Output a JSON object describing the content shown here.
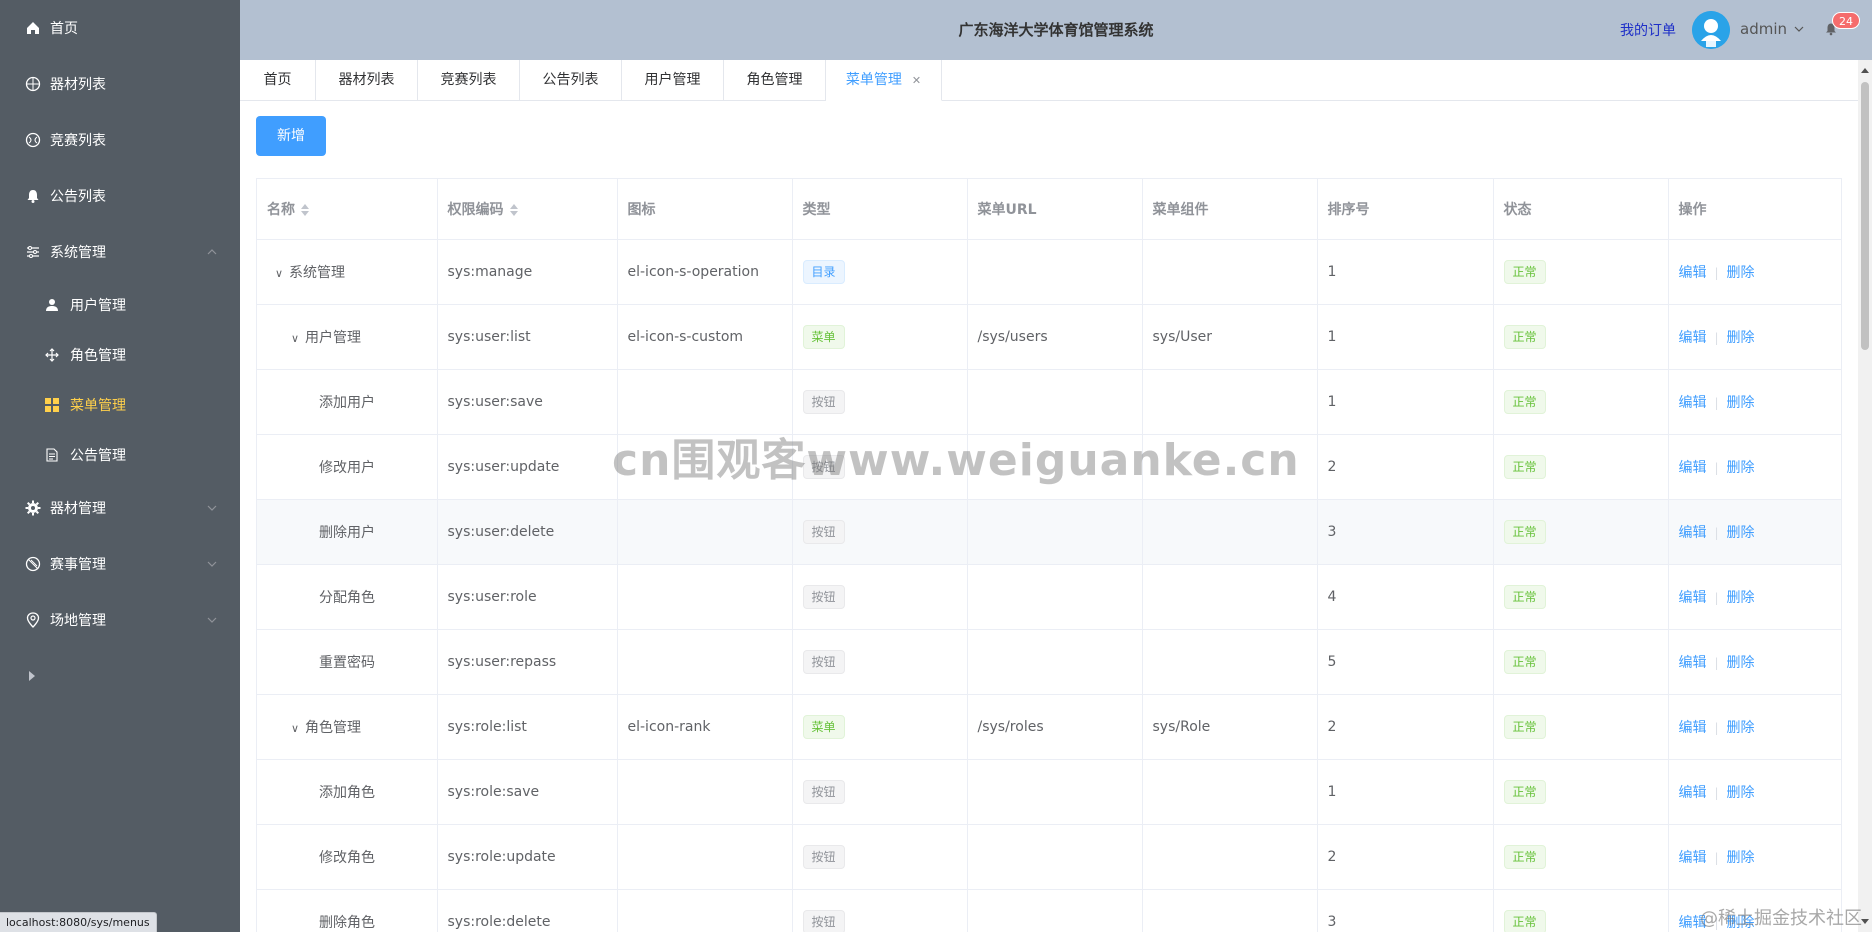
{
  "sidebar": {
    "items": [
      {
        "label": "首页",
        "icon": "home-icon"
      },
      {
        "label": "器材列表",
        "icon": "basketball-icon"
      },
      {
        "label": "竞赛列表",
        "icon": "baseball-icon"
      },
      {
        "label": "公告列表",
        "icon": "bell-icon"
      },
      {
        "label": "系统管理",
        "icon": "sliders-icon"
      },
      {
        "label": "器材管理",
        "icon": "gear-icon"
      },
      {
        "label": "赛事管理",
        "icon": "football-icon"
      },
      {
        "label": "场地管理",
        "icon": "location-icon"
      }
    ],
    "sub_items": [
      {
        "label": "用户管理",
        "icon": "user-icon"
      },
      {
        "label": "角色管理",
        "icon": "rank-icon"
      },
      {
        "label": "菜单管理",
        "icon": "grid-icon"
      },
      {
        "label": "公告管理",
        "icon": "document-icon"
      }
    ],
    "active_sub": "菜单管理"
  },
  "status_bar_url": "localhost:8080/sys/menus",
  "header": {
    "title": "广东海洋大学体育馆管理系统",
    "my_orders": "我的订单",
    "username": "admin",
    "notification_count": "24"
  },
  "tabs": [
    {
      "label": "首页"
    },
    {
      "label": "器材列表"
    },
    {
      "label": "竞赛列表"
    },
    {
      "label": "公告列表"
    },
    {
      "label": "用户管理"
    },
    {
      "label": "角色管理"
    },
    {
      "label": "菜单管理",
      "active": true,
      "closable": true
    }
  ],
  "toolbar": {
    "add_label": "新增"
  },
  "table": {
    "columns": [
      "名称",
      "权限编码",
      "图标",
      "类型",
      "菜单URL",
      "菜单组件",
      "排序号",
      "状态",
      "操作"
    ],
    "edit_label": "编辑",
    "delete_label": "删除",
    "rows": [
      {
        "name": "系统管理",
        "perm": "sys:manage",
        "icon": "el-icon-s-operation",
        "type": "目录",
        "url": "",
        "component": "",
        "order": "1",
        "status": "正常"
      },
      {
        "name": "用户管理",
        "perm": "sys:user:list",
        "icon": "el-icon-s-custom",
        "type": "菜单",
        "url": "/sys/users",
        "component": "sys/User",
        "order": "1",
        "status": "正常"
      },
      {
        "name": "添加用户",
        "perm": "sys:user:save",
        "icon": "",
        "type": "按钮",
        "url": "",
        "component": "",
        "order": "1",
        "status": "正常"
      },
      {
        "name": "修改用户",
        "perm": "sys:user:update",
        "icon": "",
        "type": "按钮",
        "url": "",
        "component": "",
        "order": "2",
        "status": "正常"
      },
      {
        "name": "删除用户",
        "perm": "sys:user:delete",
        "icon": "",
        "type": "按钮",
        "url": "",
        "component": "",
        "order": "3",
        "status": "正常"
      },
      {
        "name": "分配角色",
        "perm": "sys:user:role",
        "icon": "",
        "type": "按钮",
        "url": "",
        "component": "",
        "order": "4",
        "status": "正常"
      },
      {
        "name": "重置密码",
        "perm": "sys:user:repass",
        "icon": "",
        "type": "按钮",
        "url": "",
        "component": "",
        "order": "5",
        "status": "正常"
      },
      {
        "name": "角色管理",
        "perm": "sys:role:list",
        "icon": "el-icon-rank",
        "type": "菜单",
        "url": "/sys/roles",
        "component": "sys/Role",
        "order": "2",
        "status": "正常"
      },
      {
        "name": "添加角色",
        "perm": "sys:role:save",
        "icon": "",
        "type": "按钮",
        "url": "",
        "component": "",
        "order": "1",
        "status": "正常"
      },
      {
        "name": "修改角色",
        "perm": "sys:role:update",
        "icon": "",
        "type": "按钮",
        "url": "",
        "component": "",
        "order": "2",
        "status": "正常"
      },
      {
        "name": "删除角色",
        "perm": "sys:role:delete",
        "icon": "",
        "type": "按钮",
        "url": "",
        "component": "",
        "order": "3",
        "status": "正常"
      }
    ]
  },
  "watermarks": {
    "center": "cn围观客www.weiguanke.cn",
    "corner": "@稀土掘金技术社区"
  },
  "colors": {
    "sidebar_bg": "#545c64",
    "sidebar_active": "#ffd04b",
    "header_bg": "#b3c0d1",
    "primary": "#409eff",
    "success": "#67c23a"
  }
}
